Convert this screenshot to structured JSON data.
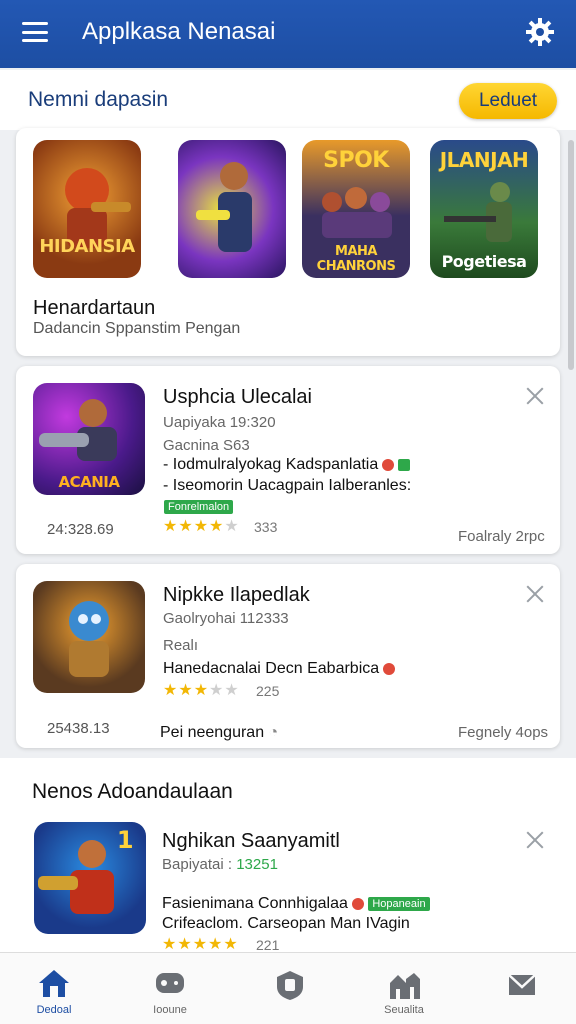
{
  "appbar": {
    "title": "Applkasa Nenasai"
  },
  "featured": {
    "heading": "Nemni dapasin",
    "button": "Leduet",
    "tiles": [
      {
        "label": "HIDANSIA",
        "sublabel": "",
        "bg": "#8a3a12"
      },
      {
        "label": "",
        "sublabel": "",
        "bg": "#4a2a9a"
      },
      {
        "label": "SPOK",
        "sublabel": "MAHA CHANRONS",
        "bg": "#3a3060"
      },
      {
        "label": "JLANJAH",
        "sublabel": "Pogetiesa",
        "bg": "#2f5a2e"
      }
    ],
    "title": "Henardartaun",
    "subtitle": "Dadancin Sppanstim Pengan"
  },
  "apps": [
    {
      "name": "Usphcia Ulecalai",
      "line1": "Uapiyaka 19:320",
      "line2": "Gacnina S63",
      "bullet1": "- Iodmulralyokag Kadspanlatia",
      "bullet2": "- Iseomorin Uacagpain Ialberanles:",
      "tag": "Fonrelmalon",
      "icon_label": "ACANIA",
      "rating": 4,
      "rating_count": "333",
      "left_number": "24:328.69",
      "right_text": "Foalraly 2rpc"
    },
    {
      "name": "Nipkke Ilapedlak",
      "line1": "Gaolryohai 112333",
      "line2": "Realı",
      "bullet1": "Hanedacnalai Decn Eabarbica",
      "bullet2": "",
      "tag": "",
      "icon_label": "",
      "rating": 3,
      "rating_count": "225",
      "left_number": "25438.13",
      "right_text": "Fegnely 4ops",
      "footer": "Pei neenguran"
    },
    {
      "name": "Nghikan Saanyamitl",
      "line1": "Bapiyatai :",
      "line1_value": "13251",
      "line2": "",
      "bullet1": "Fasienimana Connhigalaa",
      "bullet2": "Crifeaclom. Carseopan Man IVagin",
      "tag": "Hopaneain",
      "icon_label": "1",
      "rating": 5,
      "rating_count": "221",
      "left_number": "",
      "right_text": ""
    }
  ],
  "section2": {
    "heading": "Nenos Adoandaulaan"
  },
  "nav": [
    {
      "label": "Dedoal",
      "icon": "home-icon"
    },
    {
      "label": "Iooune",
      "icon": "gamepad-icon"
    },
    {
      "label": "",
      "icon": "shield-icon"
    },
    {
      "label": "Seualita",
      "icon": "buildings-icon"
    },
    {
      "label": "",
      "icon": "mail-icon"
    }
  ],
  "colors": {
    "primary": "#1d4ea3",
    "accent": "#f5b800",
    "star": "#f2b705",
    "tag": "#2ea84a"
  }
}
